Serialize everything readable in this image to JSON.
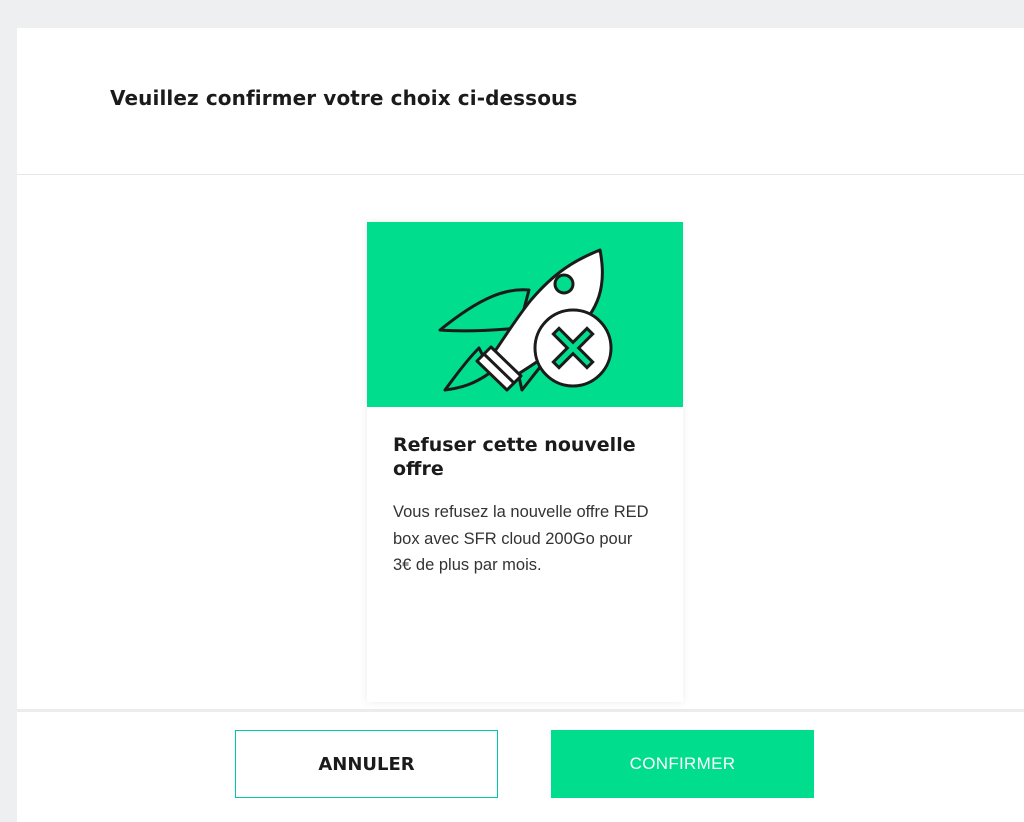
{
  "modal": {
    "title": "Veuillez confirmer votre choix ci-dessous"
  },
  "offer": {
    "title": "Refuser cette nouvelle offre",
    "description": "Vous refusez la nouvelle offre RED box avec SFR cloud 200Go pour 3€ de plus par mois.",
    "icon": "rocket-cancel-icon"
  },
  "footer": {
    "cancel_label": "ANNULER",
    "confirm_label": "CONFIRMER"
  },
  "colors": {
    "accent": "#00dd8d",
    "cancel_border": "#00c8a5",
    "text": "#1b1b1b",
    "background": "#eeeff1"
  }
}
